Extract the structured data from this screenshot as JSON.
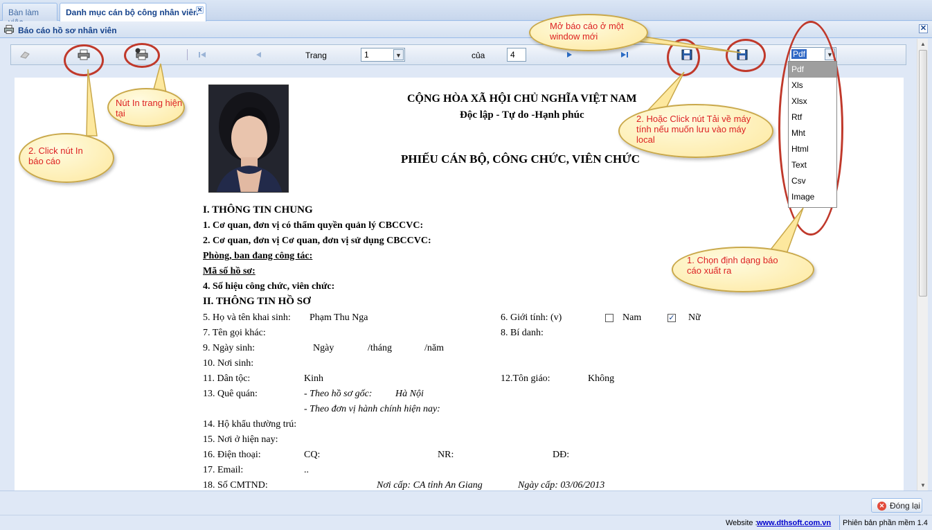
{
  "tabs": [
    {
      "label": "Bàn làm việc"
    },
    {
      "label": "Danh mục cán bộ công nhân viên",
      "close": "✕"
    }
  ],
  "panel": {
    "title": "Báo cáo hồ sơ nhân viên",
    "close": "✕"
  },
  "toolbar": {
    "page_label": "Trang",
    "page_value": "1",
    "of_label": "của",
    "total_pages": "4",
    "format_value": "Pdf"
  },
  "format_options": [
    "Pdf",
    "Xls",
    "Xlsx",
    "Rtf",
    "Mht",
    "Html",
    "Text",
    "Csv",
    "Image"
  ],
  "report": {
    "header1": "CỘNG HÒA XÃ HỘI CHỦ NGHĨA VIỆT NAM",
    "header2": "Độc lập - Tự do -Hạnh phúc",
    "title": "PHIẾU CÁN BỘ, CÔNG CHỨC, VIÊN CHỨC",
    "sec1": "I. THÔNG TIN CHUNG",
    "l1": "1.  Cơ quan, đơn vị có thẩm quyền quản lý CBCCVC:",
    "l2": "2.  Cơ quan, đơn vị Cơ quan, đơn vị sử dụng CBCCVC:",
    "l3": "Phòng, ban đang công tác:",
    "l4": "Mã số hồ sơ:",
    "l5": "4.  Số hiệu công chức, viên chức:",
    "sec2": "II. THÔNG TIN HỒ SƠ",
    "name_label": "5. Họ và tên khai sinh:",
    "name_value": "Phạm Thu Nga",
    "gender_label": "6. Giới tính: (v)",
    "male": "Nam",
    "female": "Nữ",
    "female_check": "✓",
    "other_name": "7. Tên gọi khác:",
    "alias": "8. Bí danh:",
    "dob_label": "9. Ngày sinh:",
    "dob_day": "Ngày",
    "dob_month": "/tháng",
    "dob_year": "/năm",
    "pob": "10. Nơi sinh:",
    "ethnic_label": "11. Dân tộc:",
    "ethnic_value": "Kinh",
    "religion_label": "12.Tôn giáo:",
    "religion_value": "Không",
    "home_label": "13. Quê quán:",
    "home_orig": "- Theo hồ sơ gốc:",
    "home_orig_value": "Hà Nội",
    "home_adm": "- Theo đơn vị hành chính hiện nay:",
    "household": "14. Hộ khẩu thường trú:",
    "current": "15. Nơi ở hiện nay:",
    "phone_label": "16. Điện thoại:",
    "phone_cq": "CQ:",
    "phone_nr": "NR:",
    "phone_dd": "DĐ:",
    "email_label": "17. Email:",
    "email_value": "..",
    "id_label": "18. Số CMTND:",
    "id_place": "Nơi cấp:  CA tỉnh An Giang",
    "id_date": "Ngày cấp:  03/06/2013"
  },
  "callouts": {
    "print_current": "Nút In trang hiện tại",
    "print_report": "2. Click nút In báo cáo",
    "new_window": "Mở báo cáo ở một window mới",
    "download": "2. Hoặc Click nút Tải về máy tính nếu muốn lưu vào máy local",
    "choose_format": "1. Chọn định dạng báo cáo xuất ra"
  },
  "footer": {
    "close_label": "Đóng lại",
    "close_icon": "✕"
  },
  "status": {
    "website_label": "Website :",
    "website_link": "www.dthsoft.com.vn",
    "version": "Phiên bản phần mềm 1.4"
  },
  "colors": {
    "callout_text": "#dd2222",
    "ring": "#c0392b",
    "theme_blue": "#15428b"
  }
}
